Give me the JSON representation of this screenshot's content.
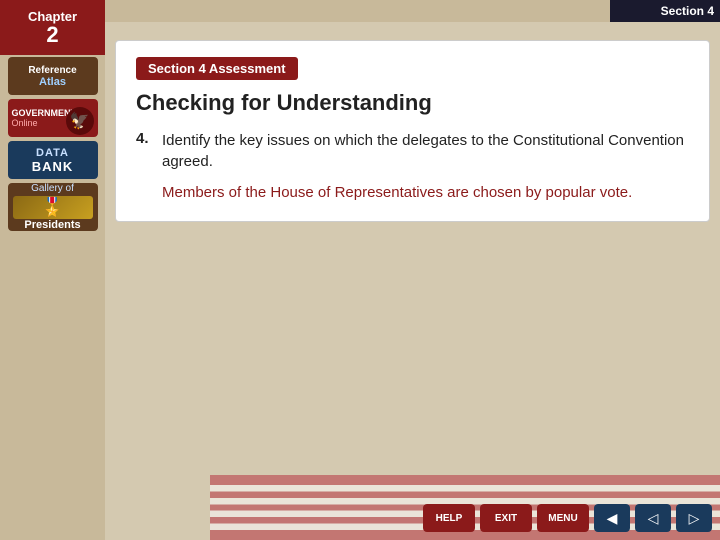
{
  "header": {
    "chapter_label": "Chapter",
    "chapter_num": "2",
    "section_label": "Section 4"
  },
  "sidebar": {
    "items": [
      {
        "id": "reference-atlas",
        "line1": "Reference",
        "line2": "Atlas"
      },
      {
        "id": "government-online",
        "line1": "GOVERNMENT",
        "line2": "Online"
      },
      {
        "id": "data-bank",
        "line1": "DATA",
        "line2": "BANK"
      },
      {
        "id": "gallery-presidents",
        "line1": "Gallery of",
        "line2": "Presidents"
      }
    ]
  },
  "main": {
    "banner": "Section 4 Assessment",
    "title": "Checking for Understanding",
    "question_num": "4.",
    "question_text": "Identify the key issues on which the delegates to the Constitutional Convention agreed.",
    "answer_text": "Members of the House of Representatives are chosen by popular vote."
  },
  "bottom_nav": {
    "help_label": "HELP",
    "exit_label": "EXIT",
    "menu_label": "MENU",
    "prev_arrow": "◀",
    "back_arrow": "◁",
    "forward_arrow": "▷"
  }
}
